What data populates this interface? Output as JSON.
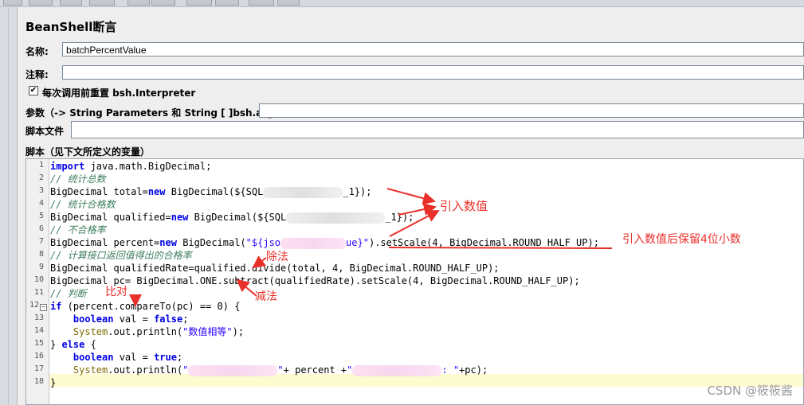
{
  "panel": {
    "title": "BeanShell断言",
    "name_label": "名称:",
    "name_value": "batchPercentValue",
    "comment_label": "注释:",
    "comment_value": "",
    "reset_checkbox_checked": true,
    "reset_label": "每次调用前重置 bsh.Interpreter",
    "params_label": "参数（-> String Parameters 和 String [ ]bsh.args）",
    "params_value": "",
    "script_file_label": "脚本文件",
    "script_file_value": "",
    "script_label": "脚本（见下文所定义的变量）"
  },
  "code": {
    "line_numbers": [
      "1",
      "2",
      "3",
      "4",
      "5",
      "6",
      "7",
      "8",
      "9",
      "10",
      "11",
      "12",
      "13",
      "14",
      "15",
      "16",
      "17",
      "18"
    ],
    "l1": {
      "kw": "import",
      "rest": " java.math.BigDecimal;"
    },
    "l2": "// 统计总数",
    "l3": {
      "a": "BigDecimal total=",
      "kw": "new",
      "b": " BigDecimal(${SQL",
      "c": "_1});"
    },
    "l4": "// 统计合格数",
    "l5": {
      "a": "BigDecimal qualified=",
      "kw": "new",
      "b": " BigDecimal(${SQL",
      "c": "_1});"
    },
    "l6": "// 不合格率",
    "l7": {
      "a": "BigDecimal percent=",
      "kw": "new",
      "b": " BigDecimal(",
      "s1": "\"${jso",
      "s2": "ue}\"",
      "c": ").setScale(4, BigDecimal.ROUND_HALF_UP);"
    },
    "l8": "// 计算接口返回值得出的合格率",
    "l9": "BigDecimal qualifiedRate=qualified.divide(total, 4, BigDecimal.ROUND_HALF_UP);",
    "l10": "BigDecimal pc= BigDecimal.ONE.subtract(qualifiedRate).setScale(4, BigDecimal.ROUND_HALF_UP);",
    "l11": "// 判断",
    "l12": {
      "kw": "if",
      "rest": " (percent.compareTo(pc) == 0) {"
    },
    "l13": {
      "kw1": "boolean",
      "a": " val = ",
      "kw2": "false",
      "b": ";"
    },
    "l14": {
      "cls": "System",
      "a": ".out.println(",
      "s": "\"数值相等\"",
      "b": ");"
    },
    "l15": {
      "a": "} ",
      "kw": "else",
      "b": " {"
    },
    "l16": {
      "kw1": "boolean",
      "a": " val = ",
      "kw2": "true",
      "b": ";"
    },
    "l17": {
      "cls": "System",
      "a": ".out.println(",
      "s1": "\"",
      "s2": "\"",
      "b": "+ percent +",
      "s3": "\"",
      "s4": ": \"",
      "c": "+pc);"
    },
    "l18": "}"
  },
  "annotations": {
    "import_value": "引入数值",
    "keep_4_decimals": "引入数值后保留4位小数",
    "divide": "除法",
    "subtract": "减法",
    "compare": "比对"
  },
  "watermark": "CSDN @筱筱酱",
  "colors": {
    "annotation": "#e8302a",
    "keyword": "#0000e6",
    "comment": "#3f7f5f",
    "string": "#2a00ff"
  }
}
